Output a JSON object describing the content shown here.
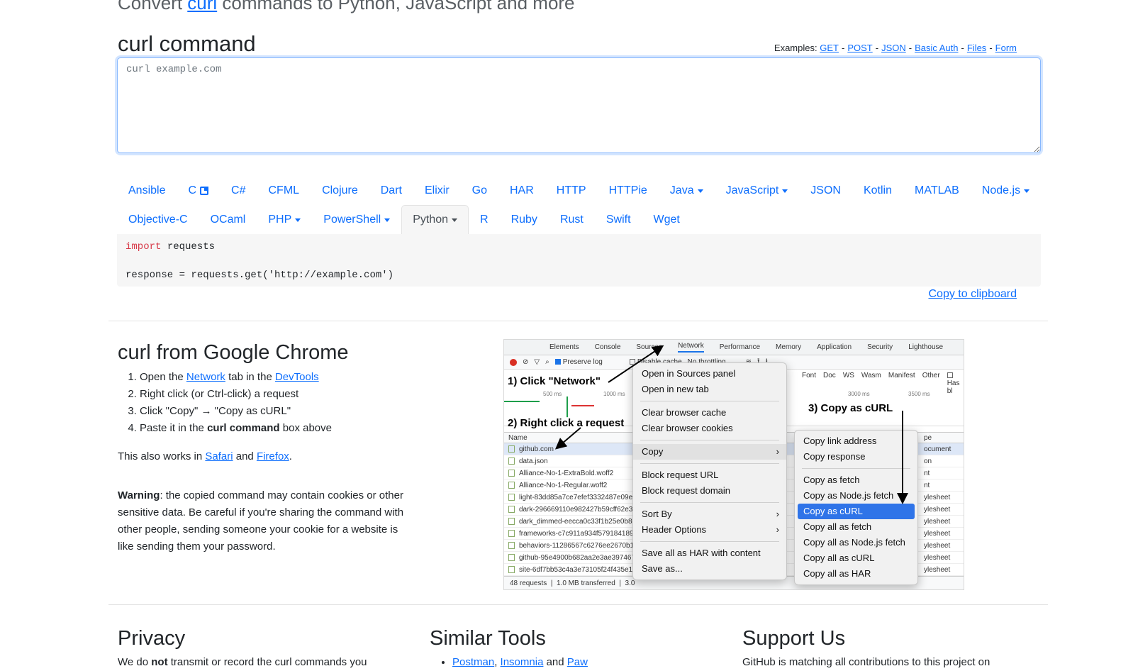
{
  "hero": {
    "prefix": "Convert ",
    "link": "curl",
    "suffix": " commands to Python, JavaScript and more"
  },
  "curl_section": {
    "title": "curl command",
    "examples_label": "Examples:",
    "examples": [
      "GET",
      "POST",
      "JSON",
      "Basic Auth",
      "Files",
      "Form"
    ],
    "placeholder": "curl example.com"
  },
  "languages": {
    "row1": [
      "Ansible",
      "C",
      "C#",
      "CFML",
      "Clojure",
      "Dart",
      "Elixir",
      "Go",
      "HAR",
      "HTTP",
      "HTTPie",
      "Java",
      "JavaScript",
      "JSON",
      "Kotlin",
      "MATLAB",
      "Node.js"
    ],
    "row2": [
      "Objective-C",
      "OCaml",
      "PHP",
      "PowerShell",
      "Python",
      "R",
      "Ruby",
      "Rust",
      "Swift",
      "Wget"
    ],
    "dropdowns": [
      "Java",
      "JavaScript",
      "Node.js",
      "PHP",
      "PowerShell",
      "Python"
    ],
    "external": [
      "C"
    ],
    "active": "Python"
  },
  "output": {
    "keyword": "import",
    "line1_rest": " requests",
    "line2": "response = requests.get('http://example.com')",
    "copy_label": "Copy to clipboard"
  },
  "chrome": {
    "title": "curl from Google Chrome",
    "step1": {
      "a": "Open the ",
      "link1": "Network",
      "b": " tab in the ",
      "link2": "DevTools"
    },
    "step2": "Right click (or Ctrl-click) a request",
    "step3": "Click \"Copy\" → \"Copy as cURL\"",
    "step4": {
      "a": "Paste it in the ",
      "bold": "curl command",
      "b": " box above"
    },
    "also": {
      "a": "This also works in ",
      "link1": "Safari",
      "b": " and ",
      "link2": "Firefox",
      "c": "."
    },
    "warning_label": "Warning",
    "warning_text": ": the copied command may contain cookies or other sensitive data. Be careful if you're sharing the command with other people, sending someone your cookie for a website is like sending them your password."
  },
  "devtools": {
    "tabs": [
      "Elements",
      "Console",
      "Sources",
      "Network",
      "Performance",
      "Memory",
      "Application",
      "Security",
      "Lighthouse"
    ],
    "active_tab": "Network",
    "toolbar": {
      "preserve_log": "Preserve log",
      "disable_cache": "Disable cache",
      "throttle": "No throttling"
    },
    "filters": [
      "Font",
      "Doc",
      "WS",
      "Wasm",
      "Manifest",
      "Other",
      "Has bl"
    ],
    "ticks": [
      "500 ms",
      "1000 ms",
      "3000 ms",
      "3500 ms"
    ],
    "name_header": "Name",
    "type_header": "pe",
    "rows": [
      {
        "name": "github.com",
        "type": "ocument"
      },
      {
        "name": "data.json",
        "type": "on"
      },
      {
        "name": "Alliance-No-1-ExtraBold.woff2",
        "type": "nt"
      },
      {
        "name": "Alliance-No-1-Regular.woff2",
        "type": "nt"
      },
      {
        "name": "light-83dd85a7ce7efef3332487e09e9",
        "type": "ylesheet"
      },
      {
        "name": "dark-296669110e982427b59cff62e3e",
        "type": "ylesheet"
      },
      {
        "name": "dark_dimmed-eecca0c33f1b25e0b8c",
        "type": "ylesheet"
      },
      {
        "name": "frameworks-c7c911a934f579184189b",
        "type": "ylesheet"
      },
      {
        "name": "behaviors-11286567c6276ee2670b1b",
        "type": "ylesheet"
      },
      {
        "name": "github-95e4900b682aa2e3ae397467c",
        "type": "ylesheet"
      },
      {
        "name": "site-6df7bb53c4a3e73105f24f435e19",
        "type": "ylesheet"
      }
    ],
    "footer": {
      "requests": "48 requests",
      "transferred": "1.0 MB transferred",
      "extra": "3.0"
    },
    "menu1": {
      "open_sources": "Open in Sources panel",
      "open_tab": "Open in new tab",
      "clear_cache": "Clear browser cache",
      "clear_cookies": "Clear browser cookies",
      "copy": "Copy",
      "block_url": "Block request URL",
      "block_domain": "Block request domain",
      "sort_by": "Sort By",
      "header_options": "Header Options",
      "save_har": "Save all as HAR with content",
      "save_as": "Save as..."
    },
    "menu2": {
      "copy_link": "Copy link address",
      "copy_response": "Copy response",
      "copy_fetch": "Copy as fetch",
      "copy_node": "Copy as Node.js fetch",
      "copy_curl": "Copy as cURL",
      "copy_all_fetch": "Copy all as fetch",
      "copy_all_node": "Copy all as Node.js fetch",
      "copy_all_curl": "Copy all as cURL",
      "copy_all_har": "Copy all as HAR"
    },
    "annotations": {
      "step1": "1) Click \"Network\"",
      "step2": "2) Right click a request",
      "step3": "3) Copy as cURL"
    }
  },
  "footer": {
    "privacy_title": "Privacy",
    "privacy_a": "We do ",
    "privacy_bold": "not",
    "privacy_b": " transmit or record the curl commands you",
    "similar_title": "Similar Tools",
    "similar_links": [
      "Postman",
      "Insomnia",
      "Paw"
    ],
    "similar_sep": ", ",
    "similar_and": " and ",
    "support_title": "Support Us",
    "support_text": "GitHub is matching all contributions to this project on"
  }
}
